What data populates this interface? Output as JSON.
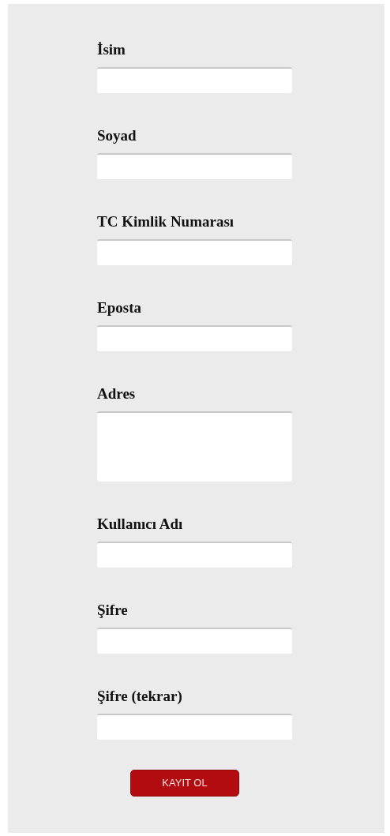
{
  "fields": [
    {
      "label": "İsim",
      "kind": "input"
    },
    {
      "label": "Soyad",
      "kind": "input"
    },
    {
      "label": "TC Kimlik Numarası",
      "kind": "input"
    },
    {
      "label": "Eposta",
      "kind": "input"
    },
    {
      "label": "Adres",
      "kind": "textarea"
    },
    {
      "label": "Kullanıcı Adı",
      "kind": "input"
    },
    {
      "label": "Şifre",
      "kind": "input"
    },
    {
      "label": "Şifre (tekrar)",
      "kind": "input"
    }
  ],
  "submit_button": "KAYIT OL"
}
